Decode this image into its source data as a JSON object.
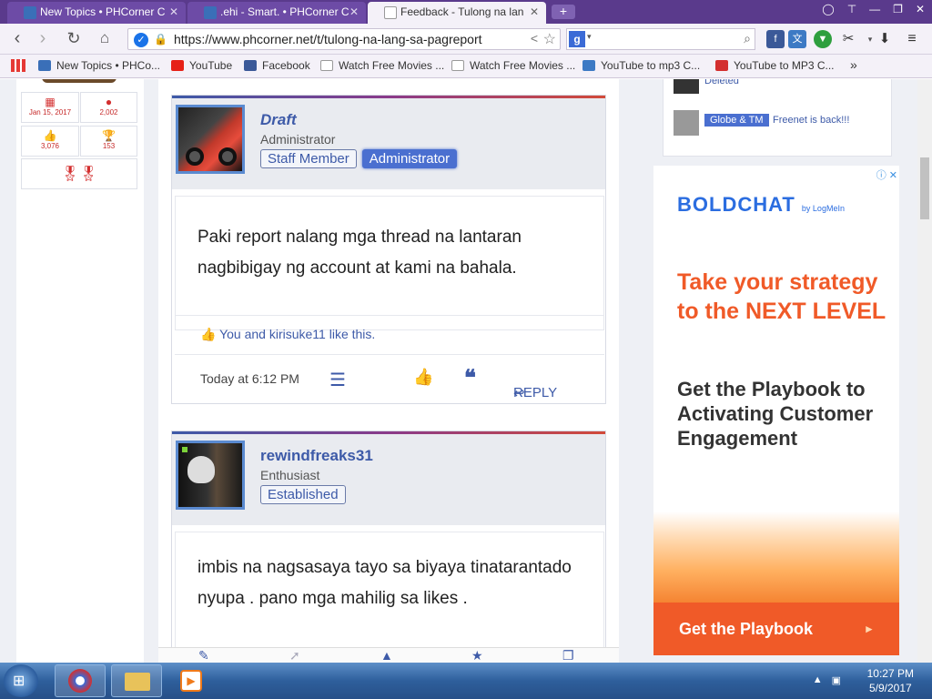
{
  "browser": {
    "tabs": [
      {
        "title": "New Topics • PHCorner C",
        "active": false
      },
      {
        "title": ".ehi - Smart. • PHCorner C",
        "active": false
      },
      {
        "title": "Feedback - Tulong na lan",
        "active": true
      }
    ],
    "new_tab": "+",
    "url": "https://www.phcorner.net/t/tulong-na-lang-sa-pagreport",
    "search_engine": "g",
    "bookmarks": [
      {
        "label": "New Topics • PHCo...",
        "icon": "phcorner-icon",
        "color": "#3a6fb8"
      },
      {
        "label": "YouTube",
        "icon": "youtube-icon",
        "color": "#e62117"
      },
      {
        "label": "Facebook",
        "icon": "facebook-icon",
        "color": "#3b5998"
      },
      {
        "label": "Watch Free Movies ...",
        "icon": "page-icon",
        "color": "#ffffff"
      },
      {
        "label": "Watch Free Movies ...",
        "icon": "page-icon",
        "color": "#ffffff"
      },
      {
        "label": "YouTube to mp3 C...",
        "icon": "mp3-icon",
        "color": "#3d7ac4"
      },
      {
        "label": "YouTube to MP3 C...",
        "icon": "youtube-mp3-icon",
        "color": "#d32f2f"
      }
    ],
    "overflow": "»"
  },
  "sidebar": {
    "stats": [
      {
        "value": "Jan 15, 2017",
        "icon": "calendar-icon"
      },
      {
        "value": "2,002",
        "icon": "message-icon"
      },
      {
        "value": "3,076",
        "icon": "like-icon"
      },
      {
        "value": "153",
        "icon": "trophy-icon"
      }
    ],
    "medals_icon": "medals-icon"
  },
  "posts": [
    {
      "username": "Draft",
      "user_title": "Administrator",
      "badges": [
        "Staff Member",
        "Administrator"
      ],
      "message": "Paki report nalang mga thread na lantaran nagbibigay ng account at kami na bahala.",
      "likes_text": "You and kirisuke11 like this.",
      "timestamp": "Today at 6:12 PM",
      "reply_label": "REPLY"
    },
    {
      "username": "rewindfreaks31",
      "user_title": "Enthusiast",
      "badges": [
        "Established"
      ],
      "message": "imbis na nagsasaya tayo sa biyaya tinatarantado nyupa . pano mga mahilig sa likes ."
    }
  ],
  "shoutbox": [
    {
      "text": "Deleted"
    },
    {
      "tag": "Globe & TM",
      "text": "Freenet is back!!!"
    }
  ],
  "ad": {
    "brand": "BOLDCHAT",
    "brand_suffix": "by LogMeIn",
    "headline": "Take your strategy to the NEXT LEVEL",
    "subhead": "Get the Playbook to Activating Customer Engagement",
    "cta": "Get the Playbook",
    "cta_arrow": "▸"
  },
  "taskbar": {
    "time": "10:27 PM",
    "date": "5/9/2017"
  },
  "colors": {
    "tabstrip": "#5a3a8c",
    "accent_blue": "#3d5aa8",
    "ad_orange": "#f05a28"
  }
}
